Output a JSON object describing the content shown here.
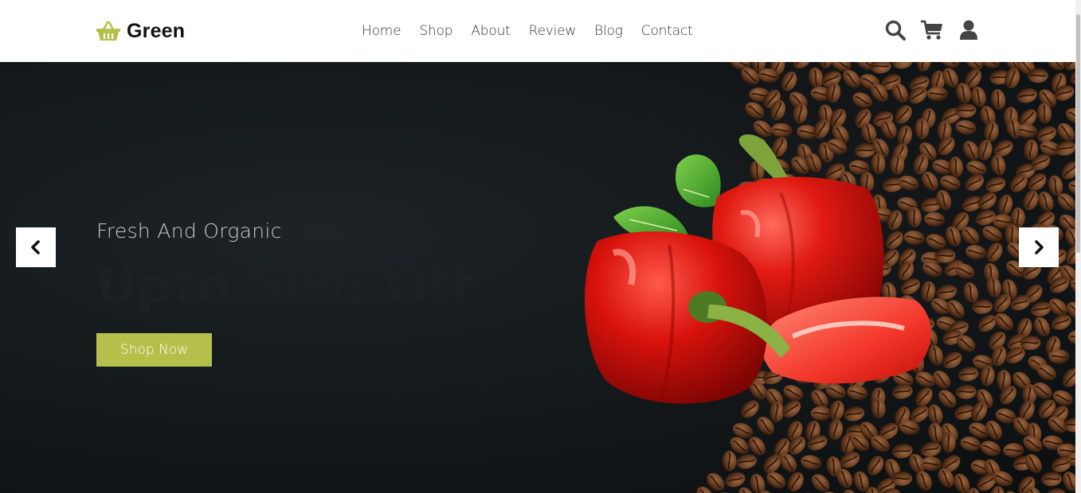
{
  "brand": {
    "name": "Green",
    "icon": "basket-icon",
    "accent_color": "#b5c04a"
  },
  "nav": {
    "items": [
      {
        "label": "Home"
      },
      {
        "label": "Shop"
      },
      {
        "label": "About"
      },
      {
        "label": "Review"
      },
      {
        "label": "Blog"
      },
      {
        "label": "Contact"
      }
    ]
  },
  "header_icons": [
    "search-icon",
    "cart-icon",
    "user-icon"
  ],
  "hero": {
    "subtitle": "Fresh And Organic",
    "headline": "Upto 50% Off",
    "cta_label": "Shop Now",
    "prev_icon": "chevron-left-icon",
    "next_icon": "chevron-right-icon"
  }
}
